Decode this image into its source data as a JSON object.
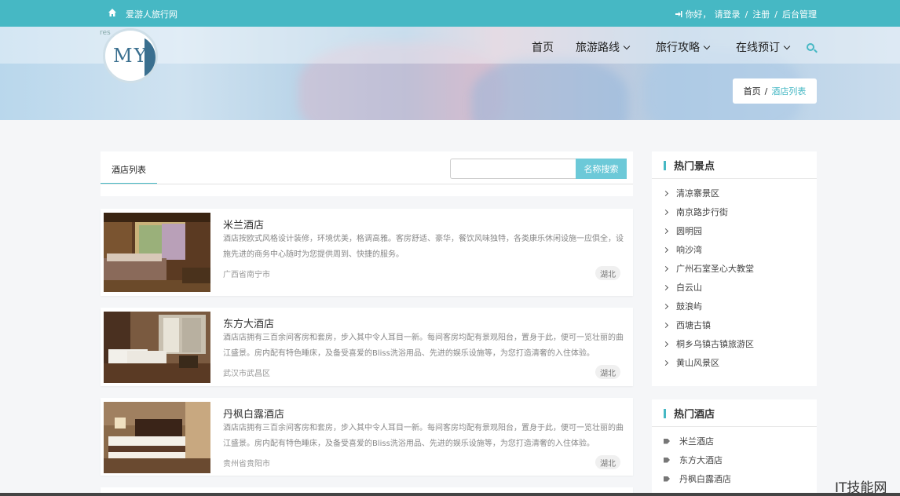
{
  "topbar": {
    "site_name": "爱游人旅行网",
    "greeting": "你好，",
    "login": "请登录",
    "register": "注册",
    "admin": "后台管理",
    "sep": "/"
  },
  "logo": {
    "text": "MY",
    "ghost": "res"
  },
  "nav": {
    "home": "首页",
    "routes": "旅游路线",
    "guides": "旅行攻略",
    "booking": "在线预订"
  },
  "breadcrumb": {
    "home": "首页",
    "sep": "/",
    "current": "酒店列表"
  },
  "main": {
    "tab_label": "酒店列表",
    "search_placeholder": "",
    "search_button": "名称搜索"
  },
  "hotels": [
    {
      "name": "米兰酒店",
      "desc": "酒店按欧式风格设计装修，环境优美，格调高雅。客房舒适、豪华，餐饮风味独特，各类康乐休闲设施一应俱全，设施先进的商务中心随时为您提供周到、快捷的服务。",
      "location": "广西省南宁市",
      "tag": "湖北"
    },
    {
      "name": "东方大酒店",
      "desc": "酒店店拥有三百余间客房和套房，步入其中令人耳目一新。每间客房均配有景观阳台，置身于此，便可一览壮丽的曲江盛景。房内配有特色睡床，及备受喜爱的Bliss洗浴用品、先进的娱乐设施等，为您打造清奢的入住体验。",
      "location": "武汉市武昌区",
      "tag": "湖北"
    },
    {
      "name": "丹枫白露酒店",
      "desc": "酒店店拥有三百余间客房和套房，步入其中令人耳目一新。每间客房均配有景观阳台，置身于此，便可一览壮丽的曲江盛景。房内配有特色睡床，及备受喜爱的Bliss洗浴用品、先进的娱乐设施等，为您打造清奢的入住体验。",
      "location": "贵州省贵阳市",
      "tag": "湖北"
    }
  ],
  "sidebar": {
    "spots_title": "热门景点",
    "spots": [
      "清凉寨景区",
      "南京路步行街",
      "圆明园",
      "响沙湾",
      "广州石室圣心大教堂",
      "白云山",
      "鼓浪屿",
      "西塘古镇",
      "桐乡乌镇古镇旅游区",
      "黄山风景区"
    ],
    "hotels_title": "热门酒店",
    "hotels": [
      "米兰酒店",
      "东方大酒店",
      "丹枫白露酒店"
    ]
  },
  "watermark": "IT技能网",
  "colors": {
    "accent": "#46b8c4",
    "button": "#6cc9d8"
  }
}
